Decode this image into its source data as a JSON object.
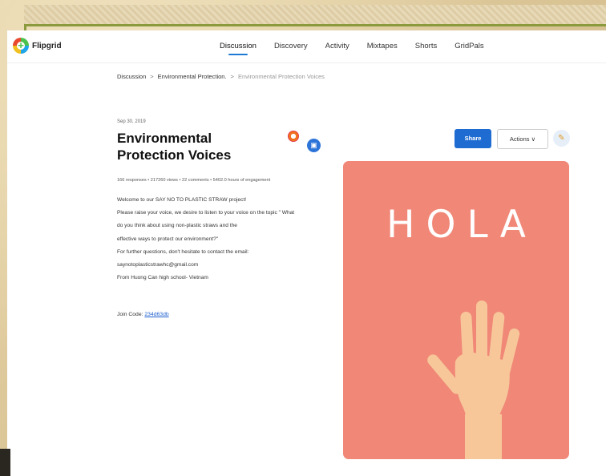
{
  "app": {
    "name": "Flipgrid"
  },
  "nav": {
    "tabs": [
      {
        "label": "Discussion",
        "active": true
      },
      {
        "label": "Discovery"
      },
      {
        "label": "Activity"
      },
      {
        "label": "Mixtapes"
      },
      {
        "label": "Shorts"
      },
      {
        "label": "GridPals"
      }
    ]
  },
  "breadcrumb": {
    "item1": "Discussion",
    "item2": "Environmental Protection.",
    "item3": "Environmental Protection Voices",
    "separator": ">"
  },
  "topic": {
    "date": "Sep 30, 2019",
    "title": "Environmental Protection Voices",
    "stats": "166 responses • 217260 views • 22 comments • 5402.0 hours of engagement",
    "description": [
      "Welcome to our SAY NO TO PLASTIC STRAW project!",
      "Please raise your voice, we desire to listen to your voice on the topic \" What",
      "do you think about using non-plastic straws and the",
      " effective ways to protect our environment?\"",
      "For further questions, don't hesitate to contact the email:",
      "saynotoplasticstrawhc@gmail.com",
      "From Huong Can high school- Vietnam"
    ],
    "join_label": "Join Code:",
    "join_code": "234d63db"
  },
  "toolbar": {
    "share_label": "Share",
    "actions_label": "Actions ∨"
  },
  "media": {
    "text": "HOLA",
    "background": "#f08777",
    "hand_color": "#f7c79a"
  },
  "colors": {
    "accent": "#1e6cd2",
    "frame_line": "#8a9a3c"
  }
}
